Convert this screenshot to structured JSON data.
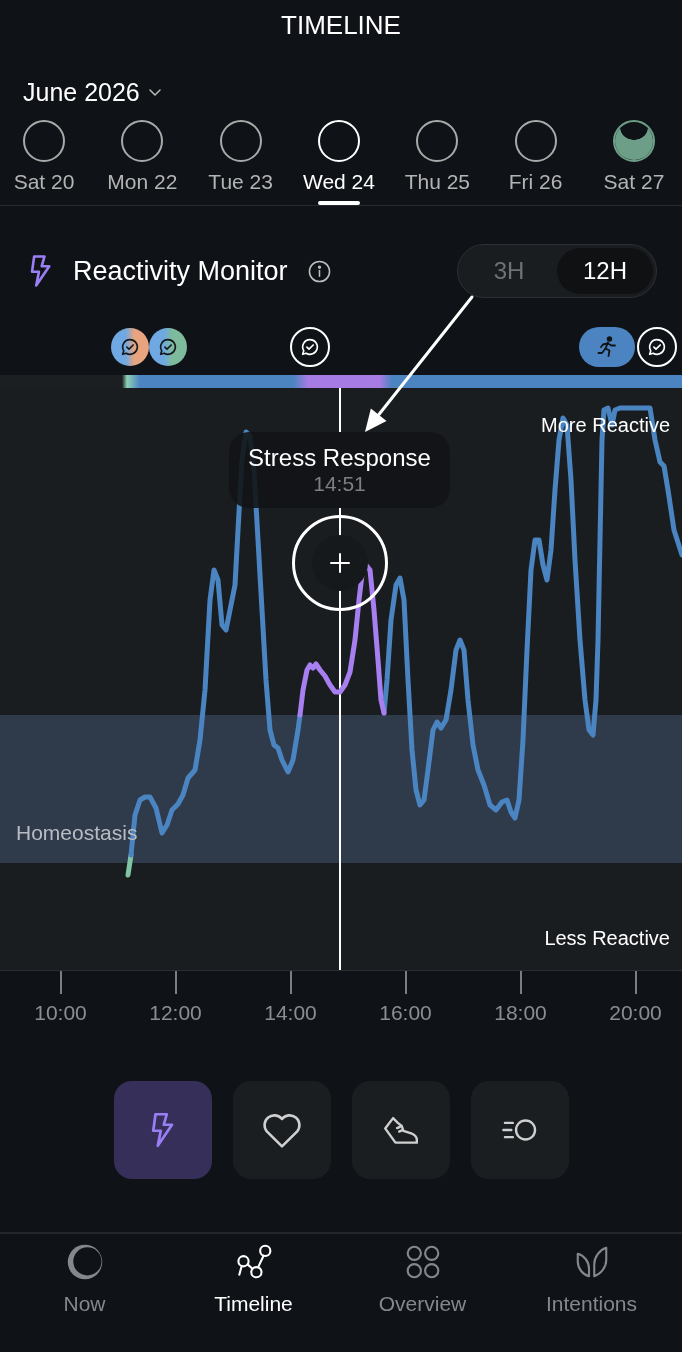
{
  "screen": {
    "title": "TIMELINE"
  },
  "month": {
    "label": "June 2026"
  },
  "days": [
    {
      "label": "Sat 20",
      "selected": false
    },
    {
      "label": "Mon 22",
      "selected": false
    },
    {
      "label": "Tue 23",
      "selected": false
    },
    {
      "label": "Wed 24",
      "selected": true
    },
    {
      "label": "Thu 25",
      "selected": false
    },
    {
      "label": "Fri 26",
      "selected": false
    },
    {
      "label": "Sat 27",
      "selected": false,
      "level": 0.85
    }
  ],
  "monitor": {
    "title": "Reactivity Monitor",
    "ranges": [
      {
        "label": "3H",
        "selected": false
      },
      {
        "label": "12H",
        "selected": true
      }
    ]
  },
  "events": [
    {
      "kind": "note",
      "color": "#e8a47e"
    },
    {
      "kind": "note",
      "color": "#7dbb9c"
    },
    {
      "kind": "note"
    },
    {
      "kind": "activity"
    },
    {
      "kind": "note"
    }
  ],
  "chart": {
    "upper_label": "More Reactive",
    "band_label": "Homeostasis",
    "lower_label": "Less Reactive",
    "tooltip": {
      "title": "Stress Response",
      "time": "14:51"
    },
    "x_ticks": [
      "10:00",
      "12:00",
      "14:00",
      "16:00",
      "18:00",
      "20:00"
    ]
  },
  "metrics": [
    {
      "kind": "reactivity",
      "selected": true
    },
    {
      "kind": "heart",
      "selected": false
    },
    {
      "kind": "steps",
      "selected": false
    },
    {
      "kind": "activity",
      "selected": false
    }
  ],
  "nav": [
    {
      "label": "Now",
      "kind": "now",
      "selected": false
    },
    {
      "label": "Timeline",
      "kind": "timeline",
      "selected": true
    },
    {
      "label": "Overview",
      "kind": "overview",
      "selected": false
    },
    {
      "label": "Intentions",
      "kind": "intentions",
      "selected": false
    }
  ]
}
